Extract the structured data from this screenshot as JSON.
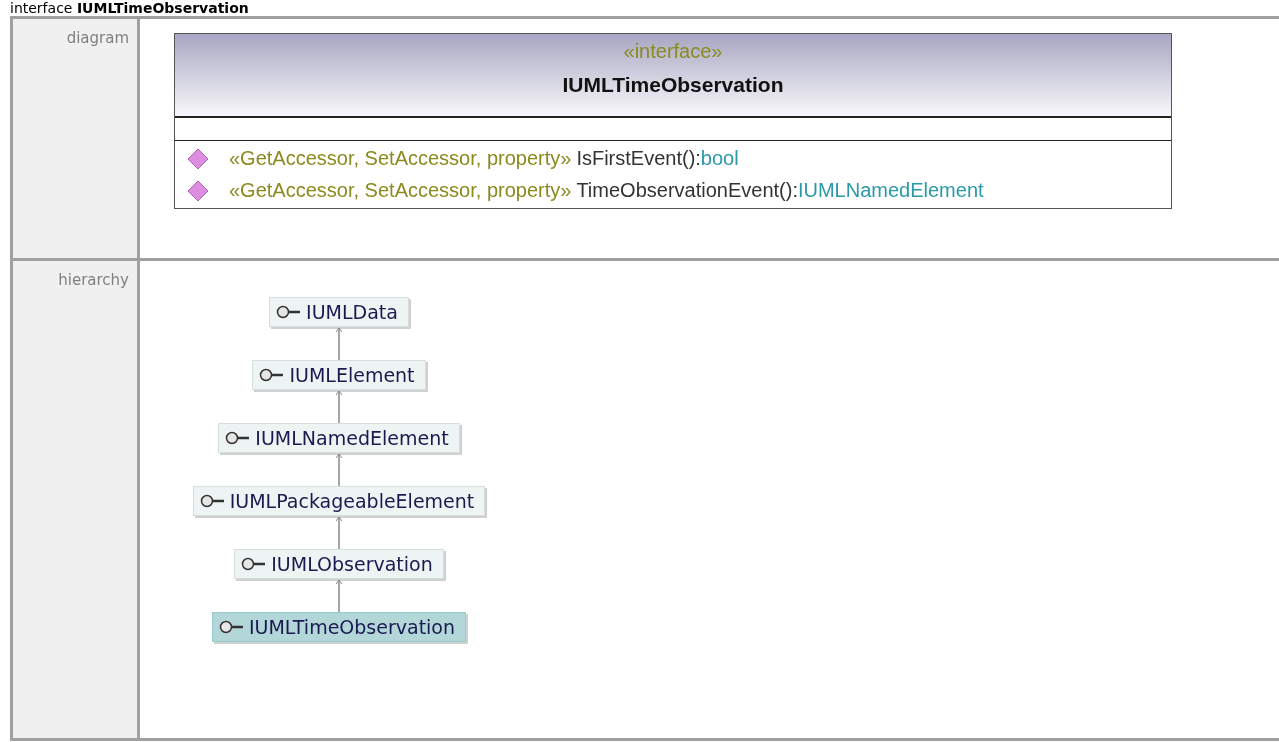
{
  "heading": "interface **IUMLTimeObservation**",
  "diagram": {
    "label": "diagram",
    "stereotype": "«interface»",
    "name": "IUMLTimeObservation",
    "operations": [
      {
        "stereotype": "«GetAccessor, SetAccessor, property»",
        "signature": "IsFirstEvent():",
        "type": "bool"
      },
      {
        "stereotype": "«GetAccessor, SetAccessor, property»",
        "signature": "TimeObservationEvent():",
        "type": "IUMLNamedElement"
      }
    ]
  },
  "hierarchy": {
    "label": "hierarchy",
    "nodes": [
      {
        "name": "IUMLData",
        "selected": false
      },
      {
        "name": "IUMLElement",
        "selected": false
      },
      {
        "name": "IUMLNamedElement",
        "selected": false
      },
      {
        "name": "IUMLPackageableElement",
        "selected": false
      },
      {
        "name": "IUMLObservation",
        "selected": false
      },
      {
        "name": "IUMLTimeObservation",
        "selected": true
      }
    ]
  }
}
